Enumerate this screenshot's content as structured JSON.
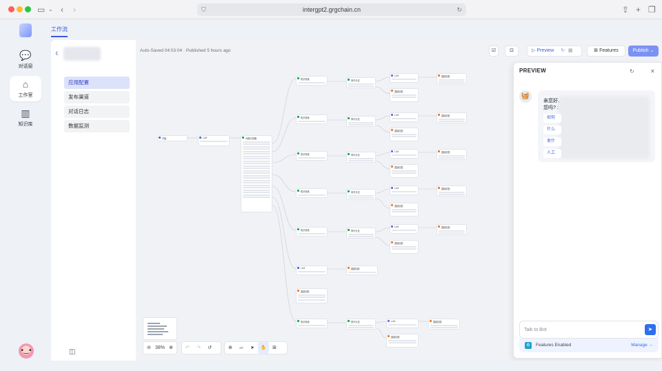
{
  "browser": {
    "url": "intergpt2.grgchain.cn",
    "tab_overview_icon": "sidebar-icon",
    "back_icon": "chevron-left-icon",
    "forward_icon": "chevron-right-icon"
  },
  "nav": {
    "items": [
      {
        "label": "对话窗",
        "icon": "chat-icon"
      },
      {
        "label": "工作室",
        "icon": "studio-icon"
      },
      {
        "label": "知识库",
        "icon": "books-icon"
      }
    ],
    "active": "工作室"
  },
  "topbar": {
    "tab": "工作流"
  },
  "settings": {
    "menu": [
      "应用配置",
      "发布渠道",
      "对话日志",
      "数据监测"
    ],
    "active": "应用配置"
  },
  "canvas": {
    "autosave": "Auto-Saved 04:03:04 · Published 5 hours ago",
    "preview_label": "Preview",
    "features_label": "Features",
    "publish_label": "Publish",
    "zoom": "38%"
  },
  "preview_panel": {
    "title": "PREVIEW",
    "greeting_line1": "亲您好,",
    "greeting_line2": "您吗? :",
    "questions": [
      "如何",
      "什么",
      "发什",
      "人工"
    ],
    "input_placeholder": "Talk to Bot",
    "features_enabled": "Features Enabled",
    "manage": "Manage →"
  },
  "colors": {
    "accent": "#3b5bdb",
    "publish": "#7b92f5",
    "send": "#2f6fed"
  }
}
